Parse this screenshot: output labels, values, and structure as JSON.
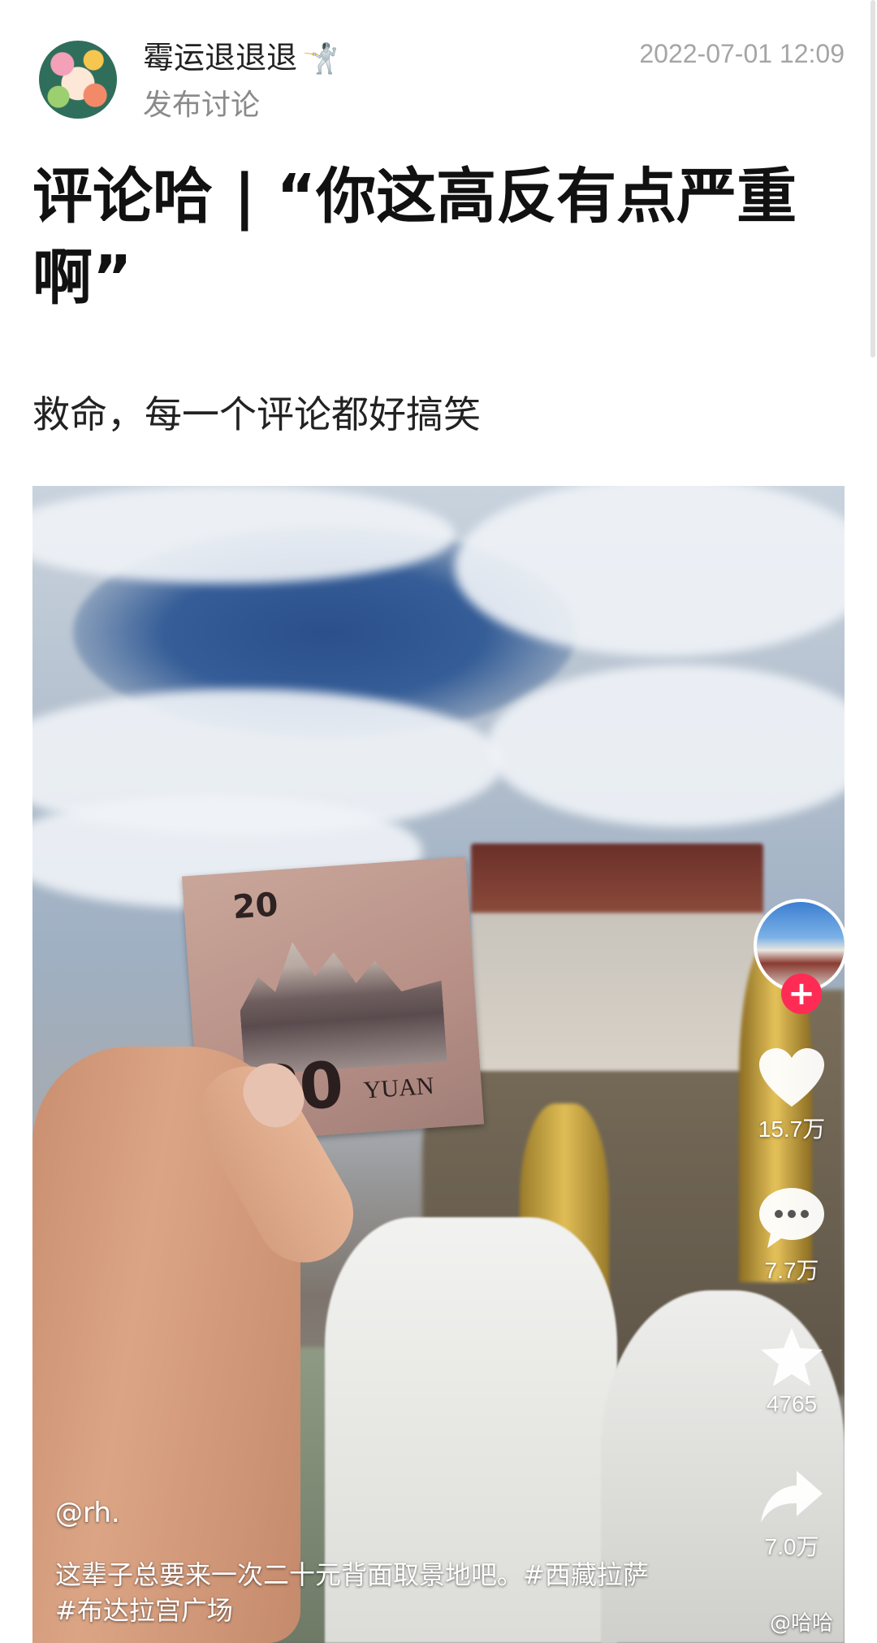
{
  "post": {
    "username": "霉运退退退",
    "user_emoji": "🤺",
    "action": "发布讨论",
    "timestamp": "2022-07-01 12:09",
    "title": "评论哈 | “你这高反有点严重啊”",
    "body": "救命，每一个评论都好搞笑"
  },
  "video": {
    "banknote": {
      "denomination": "20",
      "denomination_large": "20",
      "currency_text": "YUAN"
    },
    "author": "@rh.",
    "description": "这辈子总要来一次二十元背面取景地吧。#西藏拉萨 #布达拉宫广场",
    "sidebar": {
      "follow_label": "+",
      "likes": "15.7万",
      "comments": "7.7万",
      "favorites": "4765",
      "shares": "7.0万"
    },
    "watermark": "@哈哈"
  },
  "colors": {
    "follow_red": "#fe2c55",
    "meta_gray": "#a5a5a5"
  }
}
